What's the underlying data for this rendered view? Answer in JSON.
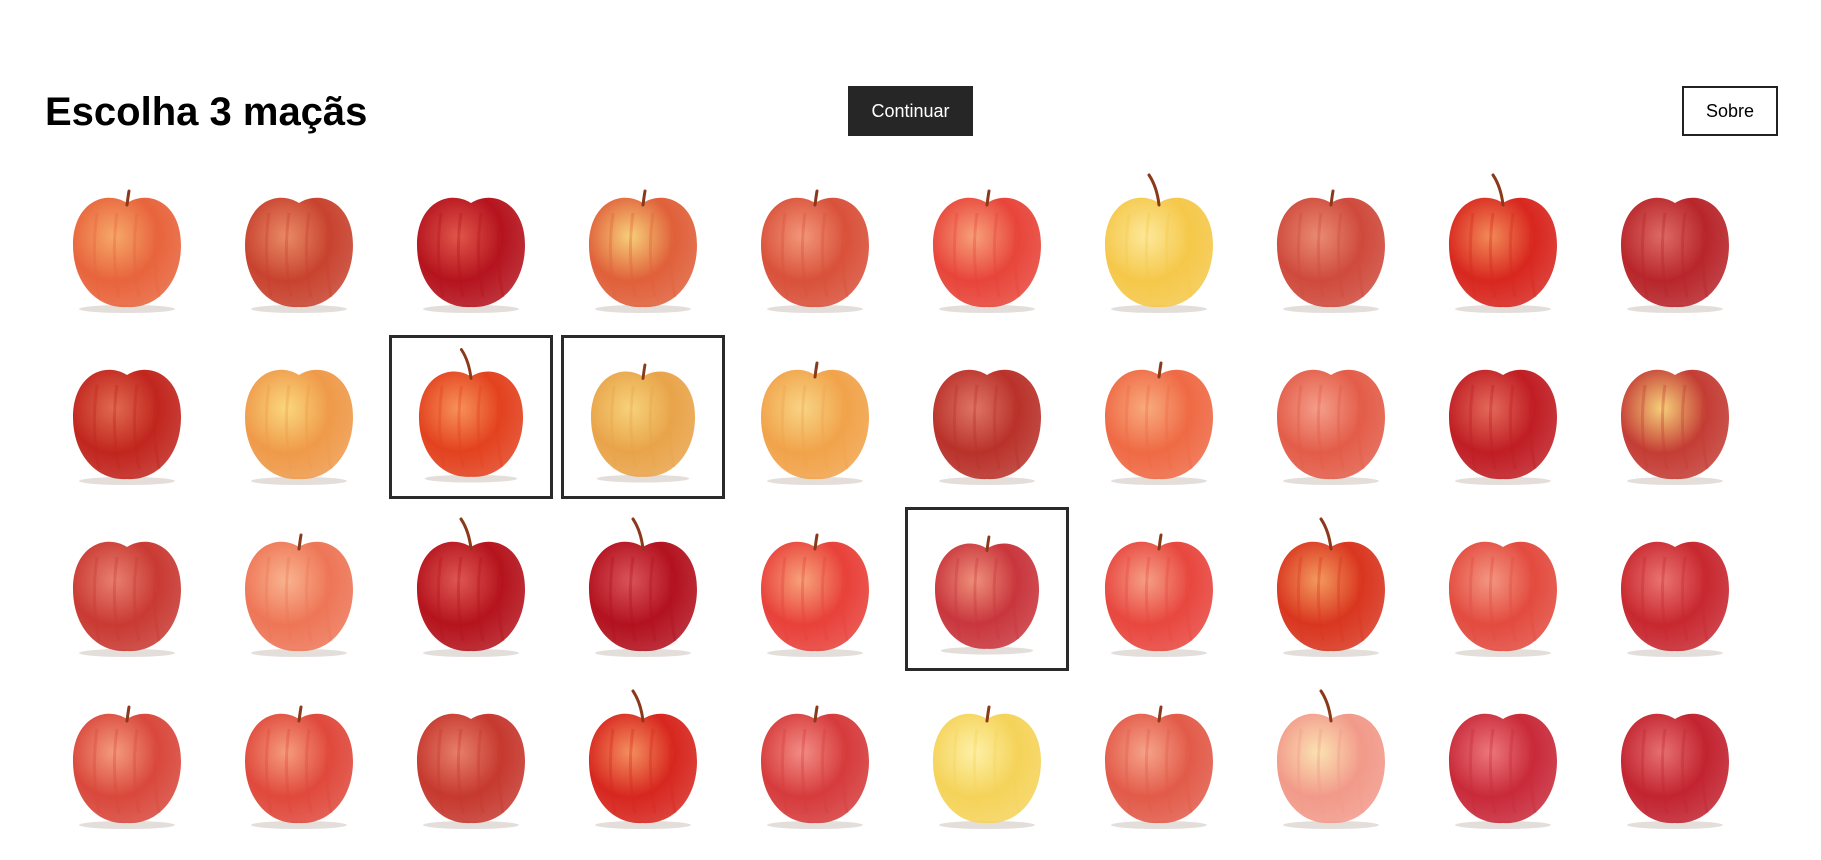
{
  "header": {
    "title": "Escolha 3 maçãs",
    "continue_label": "Continuar",
    "about_label": "Sobre"
  },
  "grid": {
    "columns": 10,
    "rows": 4,
    "apples": [
      {
        "color": "#e8643c",
        "highlight": "#f6a86a",
        "selected": false,
        "stem": true,
        "stem_long": false
      },
      {
        "color": "#c8432f",
        "highlight": "#e98a66",
        "selected": false,
        "stem": false,
        "stem_long": false
      },
      {
        "color": "#b5141e",
        "highlight": "#e0564a",
        "selected": false,
        "stem": false,
        "stem_long": false
      },
      {
        "color": "#e0603a",
        "highlight": "#f7cf7a",
        "selected": false,
        "stem": true,
        "stem_long": false
      },
      {
        "color": "#d9513a",
        "highlight": "#f2977a",
        "selected": false,
        "stem": true,
        "stem_long": false
      },
      {
        "color": "#e8453a",
        "highlight": "#f7a07a",
        "selected": false,
        "stem": true,
        "stem_long": false
      },
      {
        "color": "#f5c84a",
        "highlight": "#fde89a",
        "selected": false,
        "stem": true,
        "stem_long": true
      },
      {
        "color": "#cf4a3c",
        "highlight": "#e98b73",
        "selected": false,
        "stem": true,
        "stem_long": false
      },
      {
        "color": "#d8271f",
        "highlight": "#f28a57",
        "selected": false,
        "stem": true,
        "stem_long": true
      },
      {
        "color": "#b8262b",
        "highlight": "#dd6a66",
        "selected": false,
        "stem": false,
        "stem_long": false
      },
      {
        "color": "#c1261e",
        "highlight": "#e06a50",
        "selected": false,
        "stem": false,
        "stem_long": false
      },
      {
        "color": "#ef9a4a",
        "highlight": "#fbd77c",
        "selected": false,
        "stem": false,
        "stem_long": false
      },
      {
        "color": "#e3421f",
        "highlight": "#f7925a",
        "selected": true,
        "stem": true,
        "stem_long": true
      },
      {
        "color": "#e9a44a",
        "highlight": "#f6d27a",
        "selected": true,
        "stem": true,
        "stem_long": false
      },
      {
        "color": "#f1a34a",
        "highlight": "#f8d485",
        "selected": false,
        "stem": true,
        "stem_long": false
      },
      {
        "color": "#b9322a",
        "highlight": "#df7466",
        "selected": false,
        "stem": false,
        "stem_long": false
      },
      {
        "color": "#ef6a45",
        "highlight": "#f8ab7e",
        "selected": false,
        "stem": true,
        "stem_long": false
      },
      {
        "color": "#e35d49",
        "highlight": "#f49e8a",
        "selected": false,
        "stem": false,
        "stem_long": false
      },
      {
        "color": "#c01e24",
        "highlight": "#e36a5a",
        "selected": false,
        "stem": false,
        "stem_long": false
      },
      {
        "color": "#c43d35",
        "highlight": "#f6d07a",
        "selected": false,
        "stem": false,
        "stem_long": false
      },
      {
        "color": "#c93a33",
        "highlight": "#e87f70",
        "selected": false,
        "stem": false,
        "stem_long": false
      },
      {
        "color": "#ee7657",
        "highlight": "#f9b38f",
        "selected": false,
        "stem": true,
        "stem_long": false
      },
      {
        "color": "#b5141d",
        "highlight": "#de5753",
        "selected": false,
        "stem": true,
        "stem_long": true
      },
      {
        "color": "#b3121f",
        "highlight": "#d9545a",
        "selected": false,
        "stem": true,
        "stem_long": true
      },
      {
        "color": "#e8413a",
        "highlight": "#f7a37a",
        "selected": false,
        "stem": true,
        "stem_long": false
      },
      {
        "color": "#c9363d",
        "highlight": "#ee8f7a",
        "selected": true,
        "stem": true,
        "stem_long": false
      },
      {
        "color": "#e8473f",
        "highlight": "#f59f86",
        "selected": false,
        "stem": true,
        "stem_long": false
      },
      {
        "color": "#d9361f",
        "highlight": "#f39a5e",
        "selected": false,
        "stem": true,
        "stem_long": true
      },
      {
        "color": "#e34b3f",
        "highlight": "#f39782",
        "selected": false,
        "stem": false,
        "stem_long": false
      },
      {
        "color": "#c82830",
        "highlight": "#ea7470",
        "selected": false,
        "stem": false,
        "stem_long": false
      },
      {
        "color": "#d9483c",
        "highlight": "#f49b7d",
        "selected": false,
        "stem": true,
        "stem_long": false
      },
      {
        "color": "#e0493c",
        "highlight": "#f59c7e",
        "selected": false,
        "stem": true,
        "stem_long": false
      },
      {
        "color": "#c6392f",
        "highlight": "#e77f6b",
        "selected": false,
        "stem": false,
        "stem_long": false
      },
      {
        "color": "#d7271f",
        "highlight": "#f48f5e",
        "selected": false,
        "stem": true,
        "stem_long": true
      },
      {
        "color": "#d63b3c",
        "highlight": "#f28d85",
        "selected": false,
        "stem": true,
        "stem_long": false
      },
      {
        "color": "#f5d35a",
        "highlight": "#fdf0a6",
        "selected": false,
        "stem": true,
        "stem_long": false
      },
      {
        "color": "#e25b49",
        "highlight": "#f6a38a",
        "selected": false,
        "stem": true,
        "stem_long": false
      },
      {
        "color": "#f29a8a",
        "highlight": "#fbe2b2",
        "selected": false,
        "stem": true,
        "stem_long": true
      },
      {
        "color": "#c92a3a",
        "highlight": "#ec777b",
        "selected": false,
        "stem": false,
        "stem_long": false
      },
      {
        "color": "#c22430",
        "highlight": "#e67070",
        "selected": false,
        "stem": false,
        "stem_long": false
      }
    ]
  }
}
